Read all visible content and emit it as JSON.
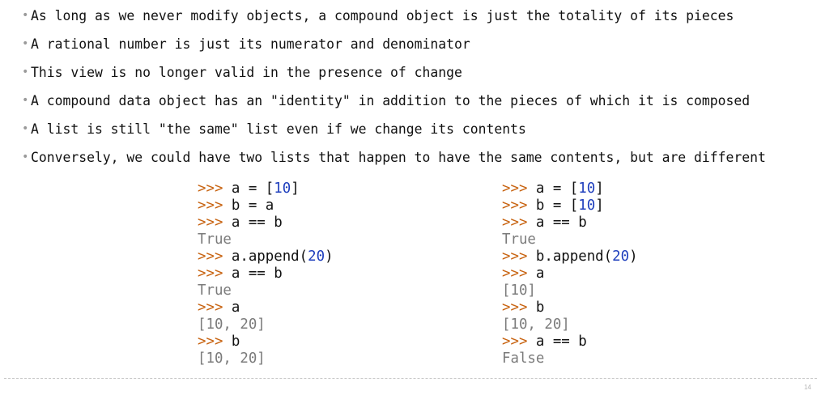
{
  "bullets": [
    "As long as we never modify objects, a compound object is just the totality of its pieces",
    "A rational number is just its numerator and denominator",
    "This view is no longer valid in the presence of change",
    "A compound data object has an \"identity\" in addition to the pieces of which it is composed",
    "A list is still \"the same\" list even if we change its contents",
    "Conversely, we could have two lists that happen to have the same contents, but are different"
  ],
  "bullet_marker": "•",
  "prompt": ">>>",
  "left_example": {
    "lines": [
      {
        "kind": "input",
        "parts": [
          {
            "t": " a = [",
            "c": "stmt"
          },
          {
            "t": "10",
            "c": "num"
          },
          {
            "t": "]",
            "c": "stmt"
          }
        ]
      },
      {
        "kind": "input",
        "parts": [
          {
            "t": " b = a",
            "c": "stmt"
          }
        ]
      },
      {
        "kind": "input",
        "parts": [
          {
            "t": " a == b",
            "c": "stmt"
          }
        ]
      },
      {
        "kind": "output",
        "parts": [
          {
            "t": "True",
            "c": "out"
          }
        ]
      },
      {
        "kind": "input",
        "parts": [
          {
            "t": " a.append(",
            "c": "stmt"
          },
          {
            "t": "20",
            "c": "num"
          },
          {
            "t": ")",
            "c": "stmt"
          }
        ]
      },
      {
        "kind": "input",
        "parts": [
          {
            "t": " a == b",
            "c": "stmt"
          }
        ]
      },
      {
        "kind": "output",
        "parts": [
          {
            "t": "True",
            "c": "out"
          }
        ]
      },
      {
        "kind": "input",
        "parts": [
          {
            "t": " a",
            "c": "stmt"
          }
        ]
      },
      {
        "kind": "output",
        "parts": [
          {
            "t": "[10, 20]",
            "c": "out"
          }
        ]
      },
      {
        "kind": "input",
        "parts": [
          {
            "t": " b",
            "c": "stmt"
          }
        ]
      },
      {
        "kind": "output",
        "parts": [
          {
            "t": "[10, 20]",
            "c": "out"
          }
        ]
      }
    ]
  },
  "right_example": {
    "lines": [
      {
        "kind": "input",
        "parts": [
          {
            "t": " a = [",
            "c": "stmt"
          },
          {
            "t": "10",
            "c": "num"
          },
          {
            "t": "]",
            "c": "stmt"
          }
        ]
      },
      {
        "kind": "input",
        "parts": [
          {
            "t": " b = [",
            "c": "stmt"
          },
          {
            "t": "10",
            "c": "num"
          },
          {
            "t": "]",
            "c": "stmt"
          }
        ]
      },
      {
        "kind": "input",
        "parts": [
          {
            "t": " a == b",
            "c": "stmt"
          }
        ]
      },
      {
        "kind": "output",
        "parts": [
          {
            "t": "True",
            "c": "out"
          }
        ]
      },
      {
        "kind": "input",
        "parts": [
          {
            "t": " b.append(",
            "c": "stmt"
          },
          {
            "t": "20",
            "c": "num"
          },
          {
            "t": ")",
            "c": "stmt"
          }
        ]
      },
      {
        "kind": "input",
        "parts": [
          {
            "t": " a",
            "c": "stmt"
          }
        ]
      },
      {
        "kind": "output",
        "parts": [
          {
            "t": "[10]",
            "c": "out"
          }
        ]
      },
      {
        "kind": "input",
        "parts": [
          {
            "t": " b",
            "c": "stmt"
          }
        ]
      },
      {
        "kind": "output",
        "parts": [
          {
            "t": "[10, 20]",
            "c": "out"
          }
        ]
      },
      {
        "kind": "input",
        "parts": [
          {
            "t": " a == b",
            "c": "stmt"
          }
        ]
      },
      {
        "kind": "output",
        "parts": [
          {
            "t": "False",
            "c": "out"
          }
        ]
      }
    ]
  },
  "page_number": "14",
  "colors": {
    "prompt": "#c86412",
    "number_literal": "#1f3fbd",
    "output": "#7b7b7b",
    "text": "#111111",
    "bullet_dot": "#9a9a9a"
  }
}
